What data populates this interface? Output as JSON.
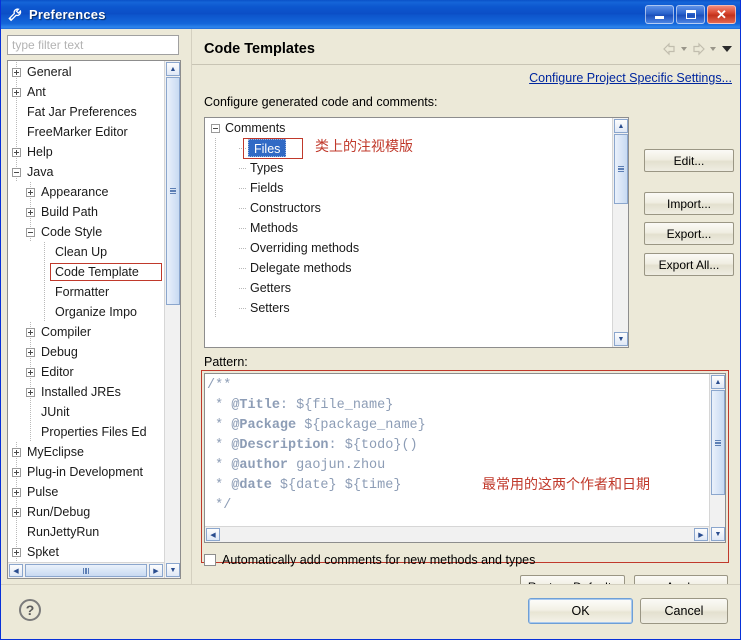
{
  "window": {
    "title": "Preferences",
    "icon": "wrench-icon",
    "buttons": {
      "minimize": "minimize-icon",
      "maximize": "maximize-icon",
      "close": "close-icon"
    }
  },
  "sidebar": {
    "filter": {
      "placeholder": "type filter text",
      "value": ""
    },
    "items": [
      {
        "label": "General",
        "indent": 0,
        "expander": "plus"
      },
      {
        "label": "Ant",
        "indent": 0,
        "expander": "plus"
      },
      {
        "label": "Fat Jar Preferences",
        "indent": 0,
        "expander": "none"
      },
      {
        "label": "FreeMarker Editor",
        "indent": 0,
        "expander": "none"
      },
      {
        "label": "Help",
        "indent": 0,
        "expander": "plus"
      },
      {
        "label": "Java",
        "indent": 0,
        "expander": "minus"
      },
      {
        "label": "Appearance",
        "indent": 1,
        "expander": "plus"
      },
      {
        "label": "Build Path",
        "indent": 1,
        "expander": "plus"
      },
      {
        "label": "Code Style",
        "indent": 1,
        "expander": "minus"
      },
      {
        "label": "Clean Up",
        "indent": 2,
        "expander": "none"
      },
      {
        "label": "Code Template",
        "indent": 2,
        "expander": "none",
        "selected": true
      },
      {
        "label": "Formatter",
        "indent": 2,
        "expander": "none"
      },
      {
        "label": "Organize Impo",
        "indent": 2,
        "expander": "none"
      },
      {
        "label": "Compiler",
        "indent": 1,
        "expander": "plus"
      },
      {
        "label": "Debug",
        "indent": 1,
        "expander": "plus"
      },
      {
        "label": "Editor",
        "indent": 1,
        "expander": "plus"
      },
      {
        "label": "Installed JREs",
        "indent": 1,
        "expander": "plus"
      },
      {
        "label": "JUnit",
        "indent": 1,
        "expander": "none"
      },
      {
        "label": "Properties Files Ed",
        "indent": 1,
        "expander": "none"
      },
      {
        "label": "MyEclipse",
        "indent": 0,
        "expander": "plus"
      },
      {
        "label": "Plug-in Development",
        "indent": 0,
        "expander": "plus"
      },
      {
        "label": "Pulse",
        "indent": 0,
        "expander": "plus"
      },
      {
        "label": "Run/Debug",
        "indent": 0,
        "expander": "plus"
      },
      {
        "label": "RunJettyRun",
        "indent": 0,
        "expander": "none"
      },
      {
        "label": "Spket",
        "indent": 0,
        "expander": "plus"
      }
    ]
  },
  "page": {
    "title": "Code Templates",
    "project_link": "Configure Project Specific Settings...",
    "configure_label": "Configure generated code and comments:",
    "nav": {
      "back": "back-arrow-icon",
      "forward": "forward-arrow-icon",
      "menu": "chevron-down-icon"
    }
  },
  "templates": {
    "root": "Comments",
    "items": [
      "Files",
      "Types",
      "Fields",
      "Constructors",
      "Methods",
      "Overriding methods",
      "Delegate methods",
      "Getters",
      "Setters"
    ],
    "selected": "Files",
    "annotation": "类上的注视模版"
  },
  "side_buttons": [
    {
      "label": "Edit...",
      "accel": "E"
    },
    {
      "label": "Import...",
      "accel": "m"
    },
    {
      "label": "Export...",
      "accel": "x"
    },
    {
      "label": "Export All...",
      "accel": ""
    }
  ],
  "pattern": {
    "label": "Pattern:",
    "lines": [
      "/**",
      " * @Title: ${file_name}",
      " * @Package ${package_name}",
      " * @Description: ${todo}()",
      " * @author gaojun.zhou",
      " * @date ${date} ${time}",
      " */"
    ],
    "text": "/**\n * @Title: ${file_name}\n * @Package ${package_name}\n * @Description: ${todo}()\n * @author gaojun.zhou\n * @date ${date} ${time}\n */",
    "annotation": "最常用的这两个作者和日期",
    "code_color": "#8d9db6"
  },
  "options": {
    "auto_comments_label": "Automatically add comments for new methods and types",
    "auto_comments_checked": false
  },
  "actions": {
    "restore_defaults": "Restore Defaults",
    "apply": "Apply",
    "ok": "OK",
    "cancel": "Cancel",
    "help": "?"
  },
  "colors": {
    "titlebar": "#0b4ec6",
    "dialog_bg": "#ece9d8",
    "selection": "#316ac5",
    "annotation": "#c0392b",
    "link": "#00269e"
  }
}
